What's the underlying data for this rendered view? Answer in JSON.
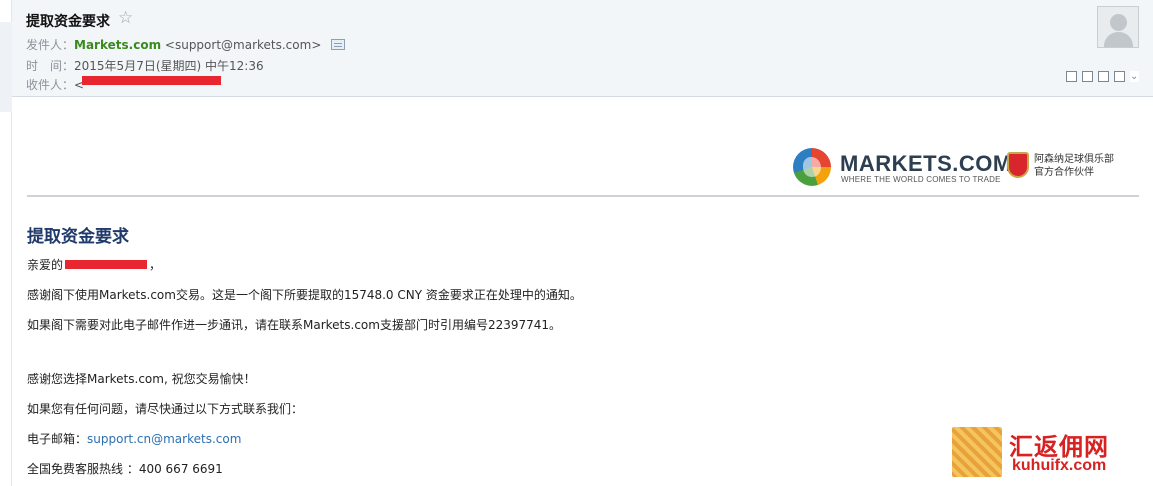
{
  "header": {
    "subject": "提取资金要求",
    "from_label": "发件人：",
    "from_name": "Markets.com",
    "from_address": "<support@markets.com>",
    "time_label": "时　间：",
    "time_value": "2015年5月7日(星期四) 中午12:36",
    "to_label": "收件人：",
    "to_value": "<"
  },
  "brand": {
    "name": "MARKETS.COM",
    "tagline": "WHERE THE WORLD COMES TO TRADE",
    "partner_line1": "阿森纳足球俱乐部",
    "partner_line2": "官方合作伙伴"
  },
  "body": {
    "title": "提取资金要求",
    "greeting_prefix": "亲爱的",
    "greeting_suffix": "，",
    "line1": "感谢阁下使用Markets.com交易。这是一个阁下所要提取的15748.0 CNY 资金要求正在处理中的通知。",
    "line2": "如果阁下需要对此电子邮件作进一步通讯，请在联系Markets.com支援部门时引用编号22397741。",
    "line3": "感谢您选择Markets.com, 祝您交易愉快！",
    "line4": "如果您有任何问题，请尽快通过以下方式联系我们：",
    "email_label": "电子邮箱：",
    "email_value": "support.cn@markets.com",
    "hotline_label": "全国免费客服热线 ：",
    "hotline_value": "400 667 6691"
  },
  "watermark": {
    "cn": "汇返佣网",
    "url": "kuhuifx.com"
  },
  "icons": [
    "star-icon",
    "vcard-icon",
    "avatar-icon",
    "popout-icon",
    "print-icon",
    "more-chevron-icon"
  ],
  "colors": {
    "sender": "#3a8a1e",
    "title": "#203a6b",
    "link": "#2c6fb3",
    "redaction": "#e8262f"
  }
}
